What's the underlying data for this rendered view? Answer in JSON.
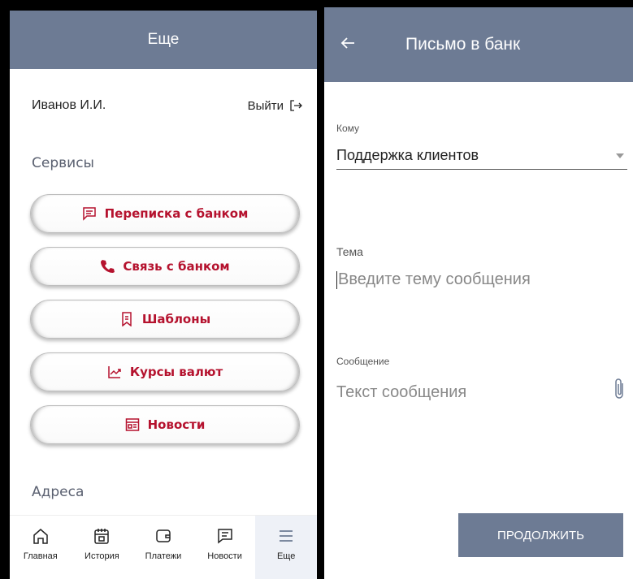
{
  "left": {
    "header_title": "Еще",
    "user_name": "Иванов И.И.",
    "logout_label": "Выйти",
    "services_title": "Сервисы",
    "services": [
      {
        "label": "Переписка с банком",
        "icon": "chat-icon"
      },
      {
        "label": "Связь с банком",
        "icon": "phone-icon"
      },
      {
        "label": "Шаблоны",
        "icon": "bookmark-icon"
      },
      {
        "label": "Курсы валют",
        "icon": "chart-icon"
      },
      {
        "label": "Новости",
        "icon": "news-icon"
      }
    ],
    "addresses_title": "Адреса",
    "nav": [
      {
        "label": "Главная",
        "icon": "home-icon"
      },
      {
        "label": "История",
        "icon": "calendar-icon"
      },
      {
        "label": "Платежи",
        "icon": "wallet-icon"
      },
      {
        "label": "Новости",
        "icon": "chat-icon"
      },
      {
        "label": "Еще",
        "icon": "menu-icon",
        "active": true
      }
    ]
  },
  "right": {
    "header_title": "Письмо в банк",
    "to_label": "Кому",
    "to_value": "Поддержка клиентов",
    "subject_label": "Тема",
    "subject_placeholder": "Введите тему сообщения",
    "message_label": "Сообщение",
    "message_placeholder": "Текст сообщения",
    "continue_label": "ПРОДОЛЖИТЬ"
  },
  "colors": {
    "header": "#6d7b94",
    "accent": "#b5122e"
  }
}
